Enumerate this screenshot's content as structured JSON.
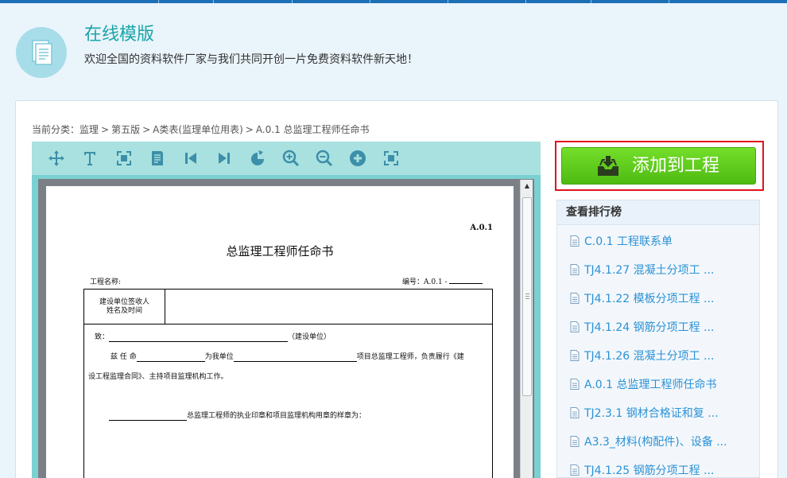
{
  "hero": {
    "title": "在线模版",
    "subtitle": "欢迎全国的资料软件厂家与我们共同开创一片免费资料软件新天地！"
  },
  "breadcrumb": {
    "prefix": "当前分类：",
    "items": [
      "监理",
      "第五版",
      "A类表(监理单位用表)",
      "A.0.1 总监理工程师任命书"
    ],
    "separator": ">"
  },
  "toolbar": {
    "tools": [
      "move-icon",
      "text-icon",
      "fit-page-icon",
      "document-icon",
      "first-page-icon",
      "last-page-icon",
      "rotate-icon",
      "zoom-in-icon",
      "zoom-out-icon",
      "add-icon",
      "fullscreen-icon"
    ]
  },
  "document": {
    "code": "A.0.1",
    "title": "总监理工程师任命书",
    "project_label": "工程名称:",
    "serial_label": "编号：A.0.1 -",
    "receiver_label_line1": "建设单位签收人",
    "receiver_label_line2": "姓名及时间",
    "to_prefix": "致：",
    "to_suffix": "（建设单位）",
    "line2_a": "兹  任  命",
    "line2_b": "为我单位",
    "line2_c": "项目总监理工程师，负责履行《建",
    "line3": "设工程监理合同》、主持项目监理机构工作。",
    "seal_line": "总监理工程师的执业印章和项目监理机构用章的样章为："
  },
  "action": {
    "add_label": "添加到工程"
  },
  "ranking": {
    "title": "查看排行榜",
    "items": [
      "C.0.1 工程联系单",
      "TJ4.1.27 混凝土分项工 ...",
      "TJ4.1.22 模板分项工程 ...",
      "TJ4.1.24 钢筋分项工程 ...",
      "TJ4.1.26 混凝土分项工 ...",
      "A.0.1 总监理工程师任命书",
      "TJ2.3.1 钢材合格证和复 ...",
      "A3.3_材料(构配件)、设备 ...",
      "TJ4.1.25 钢筋分项工程 ..."
    ]
  },
  "colors": {
    "accent_teal": "#19a5a8",
    "link_blue": "#2b92d6",
    "button_green": "#5fcc1c",
    "highlight_red": "#e0141d",
    "toolbar_bg": "#a8e1e0"
  }
}
